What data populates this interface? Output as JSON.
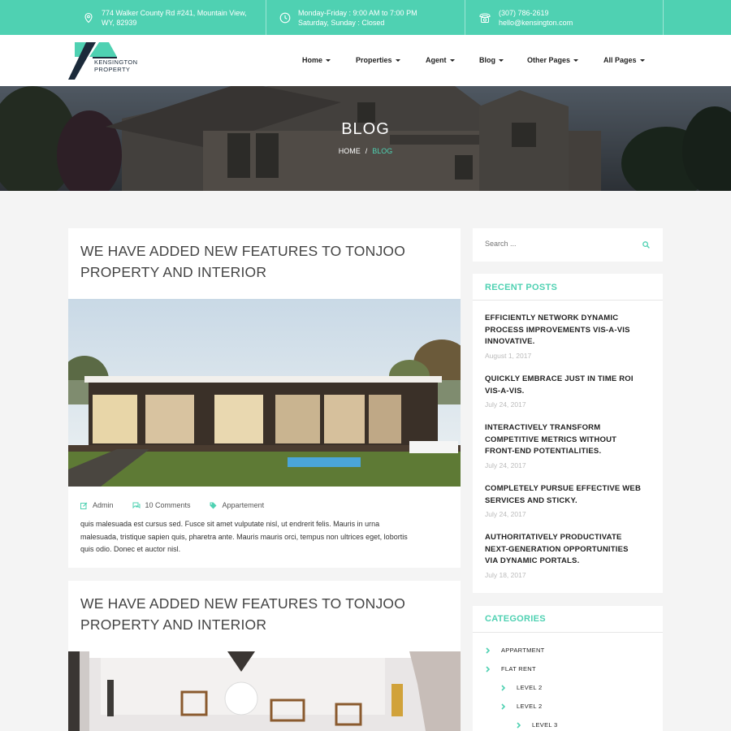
{
  "topbar": {
    "address_line1": "774 Walker County Rd #241, Mountain View,",
    "address_line2": "WY, 82939",
    "hours_line1": "Monday-Friday : 9:00 AM to 7:00 PM",
    "hours_line2": "Saturday, Sunday : Closed",
    "phone": "(307) 786-2619",
    "email": "hello@kensington.com"
  },
  "logo": {
    "line1": "KENSINGTON",
    "line2": "PROPERTY"
  },
  "nav": [
    "Home",
    "Properties",
    "Agent",
    "Blog",
    "Other Pages",
    "All Pages"
  ],
  "hero": {
    "title": "BLOG",
    "crumb_home": "HOME",
    "crumb_sep": "/",
    "crumb_current": "BLOG"
  },
  "posts": [
    {
      "title_line1": "WE HAVE ADDED NEW FEATURES TO TONJOO",
      "title_line2": "PROPERTY AND INTERIOR",
      "author": "Admin",
      "comments": "10 Comments",
      "category": "Appartement",
      "excerpt_line1": "quis malesuada est cursus sed. Fusce sit amet vulputate nisl, ut endrerit felis. Mauris in urna",
      "excerpt_line2": "malesuada, tristique sapien quis, pharetra ante. Mauris mauris orci, tempus non ultrices eget, lobortis",
      "excerpt_line3": "quis odio. Donec et auctor nisl."
    },
    {
      "title_line1": "WE HAVE ADDED NEW FEATURES TO TONJOO",
      "title_line2": "PROPERTY AND INTERIOR"
    }
  ],
  "sidebar": {
    "search_placeholder": "Search ...",
    "recent_heading": "RECENT POSTS",
    "recent": [
      {
        "l1": "EFFICIENTLY NETWORK DYNAMIC",
        "l2": "PROCESS IMPROVEMENTS VIS-A-VIS",
        "l3": "INNOVATIVE.",
        "date": "August 1, 2017"
      },
      {
        "l1": "QUICKLY EMBRACE JUST IN TIME ROI",
        "l2": "VIS-A-VIS.",
        "date": "July 24, 2017"
      },
      {
        "l1": "INTERACTIVELY TRANSFORM",
        "l2": "COMPETITIVE METRICS WITHOUT",
        "l3": "FRONT-END POTENTIALITIES.",
        "date": "July 24, 2017"
      },
      {
        "l1": "COMPLETELY PURSUE EFFECTIVE WEB",
        "l2": "SERVICES AND STICKY.",
        "date": "July 24, 2017"
      },
      {
        "l1": "AUTHORITATIVELY PRODUCTIVATE",
        "l2": "NEXT-GENERATION OPPORTUNITIES",
        "l3": "VIA DYNAMIC PORTALS.",
        "date": "July 18, 2017"
      }
    ],
    "categories_heading": "CATEGORIES",
    "categories": [
      "APPARTMENT",
      "FLAT RENT",
      "LEVEL 2",
      "LEVEL 2",
      "LEVEL 3"
    ]
  },
  "colors": {
    "accent": "#4fd1b2",
    "dark": "#1b2a3a"
  }
}
